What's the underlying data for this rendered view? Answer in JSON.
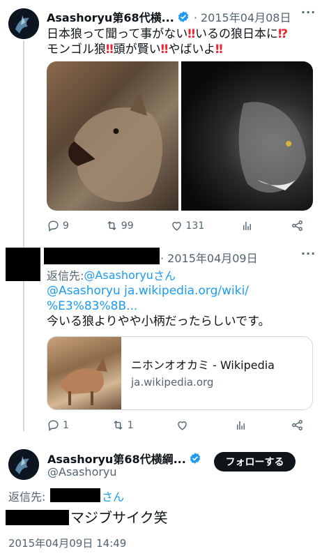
{
  "tweet1": {
    "display_name": "Asashoryu第68代横...",
    "date": "· 2015年04月08日",
    "line1_a": "日本狼って聞って事がない",
    "line1_b": "いるの狼日本に",
    "line2_a": "モンゴル狼",
    "line2_b": "頭が賢い",
    "line2_c": "やばいよ",
    "bang": "‼",
    "interrobang": "⁉",
    "replies": "9",
    "retweets": "99",
    "likes": "131"
  },
  "tweet2": {
    "date": "· 2015年04月09日",
    "reply_to_label": "返信先: ",
    "reply_to_handle": "@Asashoryu",
    "reply_to_suffix": "さん",
    "link_line1_handle": "@Asashoryu",
    "link_line1_url": " ja.wikipedia.org/wiki/",
    "link_line2": "%E3%83%8B...",
    "body": "今いる狼よりやや小柄だったらしいです。",
    "card_title": "ニホンオオカミ - Wikipedia",
    "card_domain": "ja.wikipedia.org",
    "replies": "1",
    "retweets": "1",
    "likes": ""
  },
  "tweet3": {
    "display_name": "Asashoryu第68代横綱...",
    "handle": "@Asashoryu",
    "follow_label": "フォローする",
    "reply_to_label": "返信先:",
    "reply_to_suffix": "さん",
    "body": "マジブサイク笑",
    "timestamp": "2015年04月09日 14:49"
  },
  "more_label": "···",
  "colors": {
    "accent": "#1d9bf0",
    "muted": "#536471",
    "verified": "#1d9bf0",
    "bang": "#f4212e"
  }
}
